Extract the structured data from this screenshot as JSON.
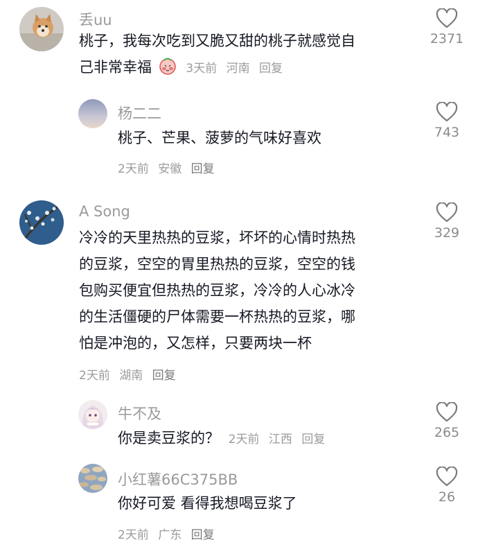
{
  "comments": [
    {
      "user": "丢uu",
      "lines": [
        "桃子，我每次吃到又脆又甜的桃子就感觉自",
        "己非常幸福"
      ],
      "time": "3天前",
      "location": "河南",
      "reply": "回复",
      "likes": "2371"
    },
    {
      "user": "杨二二",
      "lines": [
        "桃子、芒果、菠萝的气味好喜欢"
      ],
      "time": "2天前",
      "location": "安徽",
      "reply": "回复",
      "likes": "743"
    },
    {
      "user": "A Song",
      "lines": [
        "冷冷的天里热热的豆浆，坏坏的心情时热热",
        "的豆浆，空空的胃里热热的豆浆，空空的钱",
        "包购买便宜但热热的豆浆，冷冷的人心冰冷",
        "的生活僵硬的尸体需要一杯热热的豆浆，哪",
        "怕是冲泡的，又怎样，只要两块一杯"
      ],
      "time": "2天前",
      "location": "湖南",
      "reply": "回复",
      "likes": "329"
    },
    {
      "user": "牛不及",
      "lines": [
        "你是卖豆浆的？"
      ],
      "time": "2天前",
      "location": "江西",
      "reply": "回复",
      "likes": "265"
    },
    {
      "user": "小红薯66C375BB",
      "lines": [
        "你好可爱 看得我想喝豆浆了"
      ],
      "time": "2天前",
      "location": "广东",
      "reply": "回复",
      "likes": "26"
    }
  ],
  "icons": {
    "like": "heart-outline-icon",
    "emoji": "blush-face-emoji"
  },
  "colors": {
    "text": "#161823",
    "meta": "#9b9b9b",
    "heart": "#7a7a7a"
  }
}
